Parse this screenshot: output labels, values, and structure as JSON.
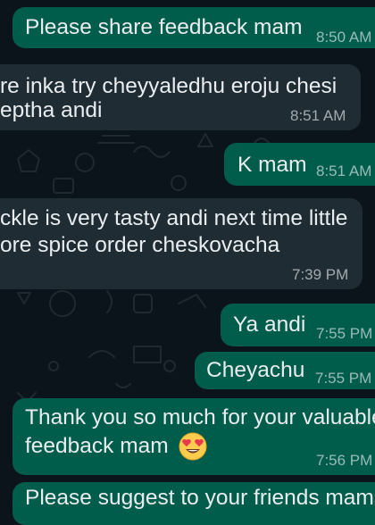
{
  "theme": {
    "background": "#0b141a",
    "outgoing_bubble": "#005c4b",
    "incoming_bubble": "#1f2c33",
    "text": "#e9edef"
  },
  "messages": [
    {
      "direction": "outgoing",
      "lines": [
        "Please share feedback mam"
      ],
      "time": "8:50 AM"
    },
    {
      "direction": "incoming",
      "lines": [
        "re inka try cheyyaledhu eroju chesi",
        "eptha andi"
      ],
      "time": "8:51 AM"
    },
    {
      "direction": "outgoing",
      "lines": [
        "K mam"
      ],
      "time": "8:51 AM"
    },
    {
      "direction": "incoming",
      "lines": [
        "ckle is very tasty andi next time little",
        "ore spice order cheskovacha"
      ],
      "time": "7:39 PM"
    },
    {
      "direction": "outgoing",
      "lines": [
        "Ya andi"
      ],
      "time": "7:55 PM"
    },
    {
      "direction": "outgoing",
      "lines": [
        "Cheyachu"
      ],
      "time": "7:55 PM"
    },
    {
      "direction": "outgoing",
      "lines": [
        "Thank you so much for your valuable",
        "feedback mam"
      ],
      "emoji": "heart-eyes-emoji",
      "time": "7:56 PM"
    },
    {
      "direction": "outgoing",
      "lines": [
        "Please suggest to your friends mam"
      ],
      "time": ""
    }
  ]
}
